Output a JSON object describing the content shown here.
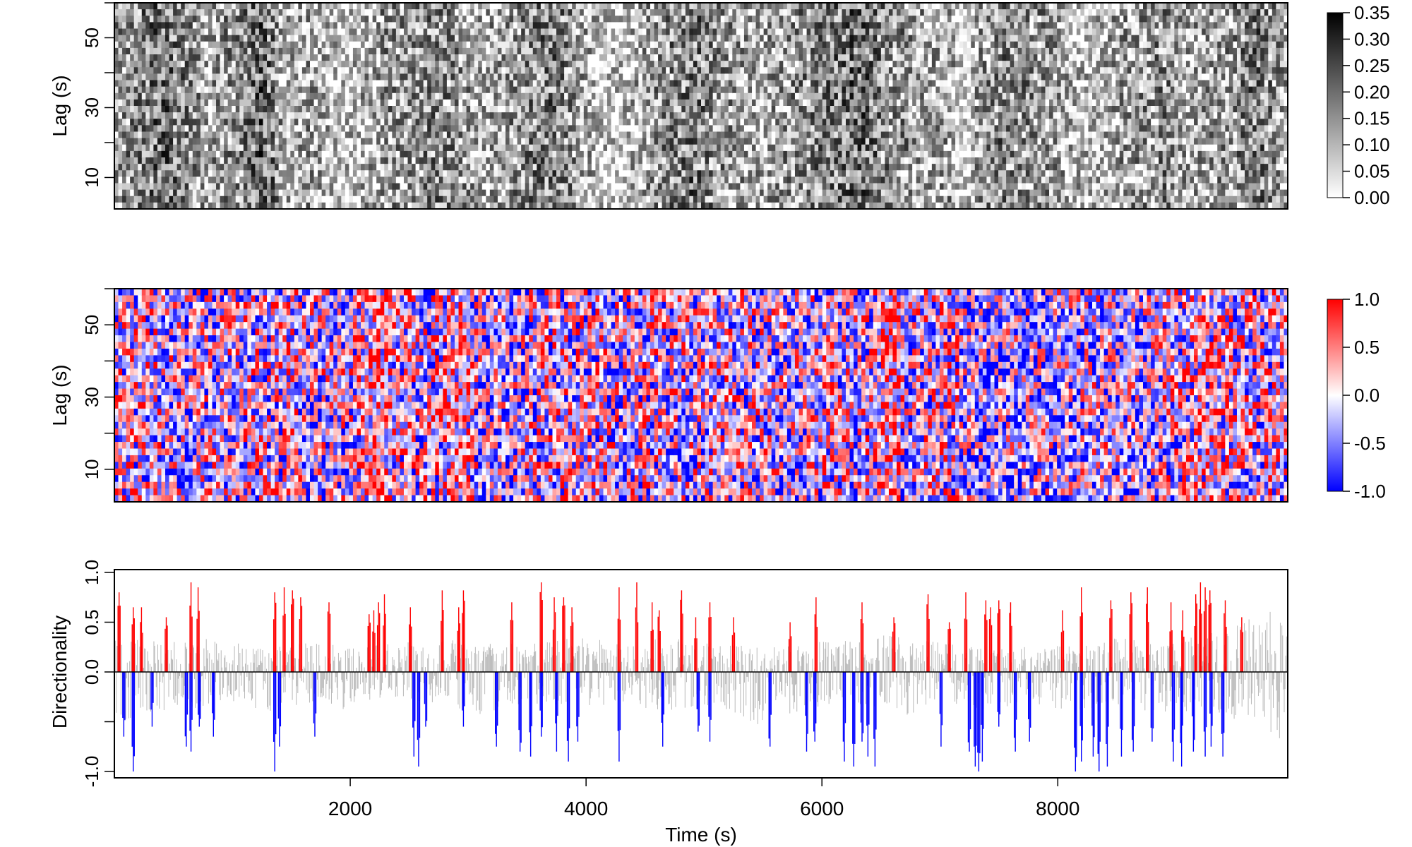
{
  "chart_data": [
    {
      "type": "heatmap",
      "panel": "top",
      "ylabel": "Lag (s)",
      "x_range": [
        0,
        9950
      ],
      "y_range": [
        1,
        60
      ],
      "y_ticks": [
        10,
        30,
        50
      ],
      "y_minor_ticks": [
        20,
        40,
        60
      ],
      "colorscale": {
        "low": "#ffffff",
        "high": "#000000",
        "range": [
          0.0,
          0.35
        ]
      },
      "colorbar_ticks": [
        "0.00",
        "0.05",
        "0.10",
        "0.15",
        "0.20",
        "0.25",
        "0.30",
        "0.35"
      ],
      "activity_profile": {
        "x": [
          0,
          300,
          420,
          600,
          800,
          1000,
          1150,
          1250,
          1350,
          1450,
          1650,
          1800,
          1950,
          2100,
          2200,
          2300,
          2500,
          2700,
          2950,
          3100,
          3300,
          3500,
          3700,
          3900,
          4100,
          4300,
          4500,
          4700,
          4900,
          5100,
          5300,
          5500,
          5700,
          5900,
          6100,
          6300,
          6500,
          6600,
          6700,
          6900,
          7100,
          7200,
          7300,
          7500,
          7700,
          7900,
          8100,
          8300,
          8500,
          8700,
          8900,
          9100,
          9300,
          9500,
          9700,
          9950
        ],
        "mean_value": [
          0.12,
          0.17,
          0.2,
          0.15,
          0.12,
          0.14,
          0.17,
          0.22,
          0.16,
          0.08,
          0.12,
          0.09,
          0.06,
          0.1,
          0.09,
          0.14,
          0.12,
          0.16,
          0.13,
          0.1,
          0.12,
          0.15,
          0.17,
          0.14,
          0.07,
          0.06,
          0.12,
          0.15,
          0.18,
          0.14,
          0.12,
          0.1,
          0.13,
          0.15,
          0.17,
          0.2,
          0.16,
          0.13,
          0.14,
          0.11,
          0.12,
          0.02,
          0.11,
          0.16,
          0.14,
          0.13,
          0.09,
          0.07,
          0.11,
          0.13,
          0.15,
          0.1,
          0.12,
          0.14,
          0.18,
          0.1
        ]
      }
    },
    {
      "type": "heatmap",
      "panel": "middle",
      "ylabel": "Lag (s)",
      "x_range": [
        0,
        9950
      ],
      "y_range": [
        1,
        60
      ],
      "y_ticks": [
        10,
        30,
        50
      ],
      "y_minor_ticks": [
        20,
        40,
        60
      ],
      "colorscale": {
        "low": "#0000ff",
        "mid": "#ffffff",
        "high": "#ff0000",
        "range": [
          -1.0,
          1.0
        ]
      },
      "colorbar_ticks": [
        "1.0",
        "0.5",
        "0.0",
        "-0.5",
        "-1.0"
      ],
      "bias_profile": {
        "x": [
          0,
          300,
          600,
          900,
          1050,
          1150,
          1300,
          1450,
          1700,
          2000,
          2200,
          2400,
          2600,
          2800,
          2950,
          3100,
          3400,
          3700,
          4000,
          4300,
          4600,
          4900,
          5200,
          5500,
          5800,
          6100,
          6300,
          6500,
          6620,
          6700,
          6900,
          7100,
          7300,
          7500,
          7800,
          8100,
          8400,
          8700,
          9000,
          9300,
          9600,
          9950
        ],
        "mean_value": [
          0.05,
          0.0,
          -0.15,
          -0.1,
          0.0,
          0.0,
          -0.1,
          0.1,
          -0.1,
          -0.05,
          0.35,
          0.1,
          -0.05,
          0.1,
          0.3,
          -0.2,
          -0.2,
          0.05,
          0.05,
          -0.1,
          0.0,
          -0.1,
          0.05,
          -0.1,
          -0.15,
          0.05,
          -0.2,
          0.2,
          0.5,
          -0.2,
          0.0,
          0.1,
          -0.35,
          -0.3,
          -0.15,
          -0.2,
          -0.1,
          -0.3,
          0.05,
          0.15,
          0.05,
          0.0
        ]
      }
    },
    {
      "type": "bar",
      "panel": "bottom",
      "ylabel": "Directionality",
      "xlabel": "Time (s)",
      "xlim": [
        0,
        9950
      ],
      "ylim": [
        -1.0,
        1.0
      ],
      "x_ticks": [
        2000,
        4000,
        6000,
        8000
      ],
      "y_tick_labels": [
        "1.0",
        "0.5",
        "0.0",
        "-1.0"
      ],
      "y_tick_values": [
        1.0,
        0.5,
        0.0,
        -1.0
      ],
      "baseline": 0.0,
      "colors": {
        "positive_significant": "#ff0000",
        "negative_significant": "#0000ff",
        "not_significant": "#a0a0a0"
      },
      "significant_positive_x": [
        40,
        160,
        230,
        440,
        650,
        710,
        1360,
        1440,
        1510,
        1580,
        1820,
        2160,
        2200,
        2240,
        2290,
        2510,
        2780,
        2920,
        2960,
        3370,
        3620,
        3730,
        3810,
        3880,
        4280,
        4430,
        4560,
        4620,
        4810,
        4930,
        5050,
        5250,
        5730,
        5950,
        6340,
        6610,
        6900,
        7080,
        7220,
        7390,
        7430,
        7500,
        7600,
        8040,
        8200,
        8450,
        8620,
        8760,
        8960,
        9060,
        9170,
        9210,
        9250,
        9290,
        9420,
        9560
      ],
      "significant_positive_y": [
        0.8,
        0.65,
        0.65,
        0.55,
        0.9,
        0.85,
        0.8,
        0.85,
        0.82,
        0.75,
        0.7,
        0.58,
        0.62,
        0.7,
        0.78,
        0.65,
        0.82,
        0.65,
        0.82,
        0.7,
        0.9,
        0.75,
        0.75,
        0.65,
        0.85,
        0.9,
        0.7,
        0.62,
        0.82,
        0.55,
        0.7,
        0.55,
        0.5,
        0.75,
        0.7,
        0.55,
        0.78,
        0.5,
        0.8,
        0.72,
        0.65,
        0.72,
        0.7,
        0.62,
        0.85,
        0.72,
        0.8,
        0.85,
        0.7,
        0.62,
        0.78,
        0.9,
        0.85,
        0.82,
        0.72,
        0.55
      ],
      "significant_negative_x": [
        80,
        160,
        320,
        610,
        650,
        720,
        840,
        1360,
        1400,
        1700,
        2540,
        2580,
        2640,
        2960,
        3240,
        3440,
        3530,
        3620,
        3750,
        3850,
        3930,
        4280,
        4650,
        4950,
        5050,
        5560,
        5870,
        5940,
        6190,
        6270,
        6340,
        6390,
        6450,
        7010,
        7250,
        7300,
        7330,
        7360,
        7500,
        7640,
        7760,
        8150,
        8200,
        8300,
        8350,
        8420,
        8540,
        8640,
        8800,
        8980,
        9050,
        9150,
        9250,
        9300,
        9400
      ],
      "significant_negative_y": [
        -0.65,
        -1.0,
        -0.55,
        -0.75,
        -0.8,
        -0.55,
        -0.65,
        -1.0,
        -0.75,
        -0.65,
        -0.85,
        -0.95,
        -0.55,
        -0.55,
        -0.75,
        -0.8,
        -0.85,
        -0.65,
        -0.8,
        -0.9,
        -0.7,
        -0.9,
        -0.75,
        -0.6,
        -0.7,
        -0.75,
        -0.8,
        -0.7,
        -0.9,
        -0.95,
        -0.7,
        -0.85,
        -0.95,
        -0.75,
        -0.8,
        -0.95,
        -1.0,
        -0.9,
        -0.55,
        -0.8,
        -0.7,
        -1.0,
        -0.9,
        -0.85,
        -1.0,
        -0.95,
        -0.85,
        -0.8,
        -0.7,
        -0.9,
        -0.95,
        -0.8,
        -0.85,
        -0.75,
        -0.85
      ],
      "grey_envelope": {
        "x": [
          0,
          400,
          800,
          1100,
          1300,
          1700,
          2000,
          2300,
          2700,
          3100,
          3500,
          3900,
          4300,
          4700,
          5100,
          5500,
          5900,
          6300,
          6500,
          6700,
          7000,
          7300,
          7700,
          8100,
          8500,
          8900,
          9300,
          9700,
          9950
        ],
        "upper": [
          0.35,
          0.3,
          0.35,
          0.28,
          0.25,
          0.3,
          0.25,
          0.3,
          0.35,
          0.3,
          0.28,
          0.35,
          0.3,
          0.35,
          0.3,
          0.25,
          0.3,
          0.35,
          0.4,
          0.35,
          0.3,
          0.25,
          0.25,
          0.3,
          0.35,
          0.3,
          0.4,
          0.6,
          0.7
        ],
        "lower": [
          -0.5,
          -0.4,
          -0.35,
          -0.3,
          -0.45,
          -0.3,
          -0.4,
          -0.25,
          -0.35,
          -0.45,
          -0.35,
          -0.4,
          -0.35,
          -0.4,
          -0.35,
          -0.55,
          -0.35,
          -0.4,
          -0.35,
          -0.45,
          -0.3,
          -0.4,
          -0.35,
          -0.4,
          -0.35,
          -0.45,
          -0.4,
          -0.55,
          -0.75
        ]
      }
    }
  ]
}
